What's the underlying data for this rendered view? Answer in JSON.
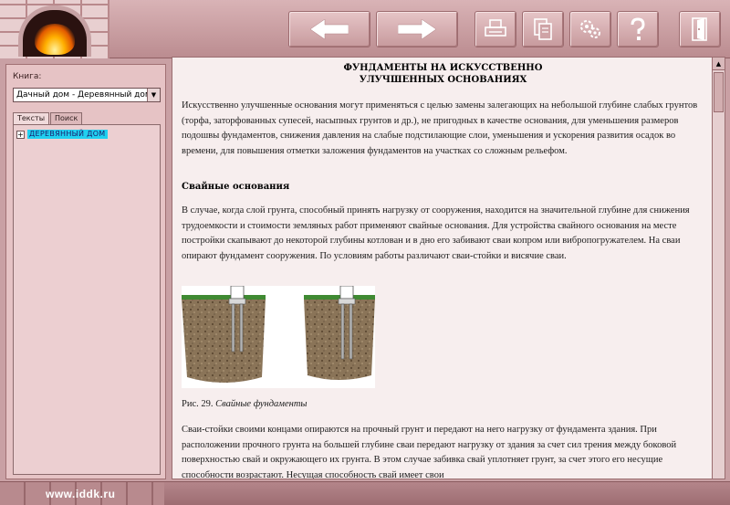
{
  "toolbar": {
    "buttons": [
      {
        "name": "back-button",
        "icon": "arrow-left-icon"
      },
      {
        "name": "forward-button",
        "icon": "arrow-right-icon"
      },
      {
        "name": "print-button",
        "icon": "printer-icon"
      },
      {
        "name": "copy-button",
        "icon": "copy-icon"
      },
      {
        "name": "settings-button",
        "icon": "gears-icon"
      },
      {
        "name": "help-button",
        "icon": "question-icon"
      },
      {
        "name": "exit-button",
        "icon": "door-exit-icon"
      }
    ]
  },
  "sidebar": {
    "book_label": "Книга:",
    "book_selected": "Дачный дом - Деревянный дом",
    "tabs": [
      "Тексты",
      "Поиск"
    ],
    "active_tab": 0,
    "tree_items": [
      {
        "label": "ДЕРЕВЯННЫЙ ДОМ",
        "expander": "+"
      }
    ]
  },
  "document": {
    "title_line1": "ФУНДАМЕНТЫ НА ИСКУССТВЕННО",
    "title_line2": "УЛУЧШЕННЫХ ОСНОВАНИЯХ",
    "para1": "Искусственно улучшенные основания могут применяться с целью замены залегающих на небольшой глубине слабых грунтов (торфа, заторфованных супесей, насыпных грунтов и др.), не пригодных в качестве основания, для уменьшения размеров подошвы фундаментов, снижения давления на слабые подстилающие слои, уменьшения и ускорения развития осадок во времени, для повышения отметки заложения фундаментов на участках со сложным рельефом.",
    "section_heading": "Свайные основания",
    "para2": "В случае, когда слой грунта, способный принять нагрузку от сооружения, находится на значительной глубине для снижения трудоемкости и стоимости земляных работ применяют свайные основания. Для устройства свайного основания на месте постройки скапывают до некоторой глубины котлован и в дно его забивают сваи копром или вибропогружателем. На сваи опирают фундамент сооружения. По условиям работы различают сваи-стойки и висячие сваи.",
    "caption_prefix": "Рис. 29.",
    "caption_text": "Свайные фундаменты",
    "para3": "Сваи-стойки своими концами опираются на прочный грунт и передают на него нагрузку от фундамента здания. При расположении прочного грунта на большей глубине сваи передают нагрузку от здания за счет сил трения между боковой поверхностью свай и окружающего их грунта. В этом случае забивка свай уплотняет грунт, за счет этого его несущие способности возрастают. Несущая способность свай имеет свои"
  },
  "footer": {
    "url": "www.iddk.ru"
  }
}
